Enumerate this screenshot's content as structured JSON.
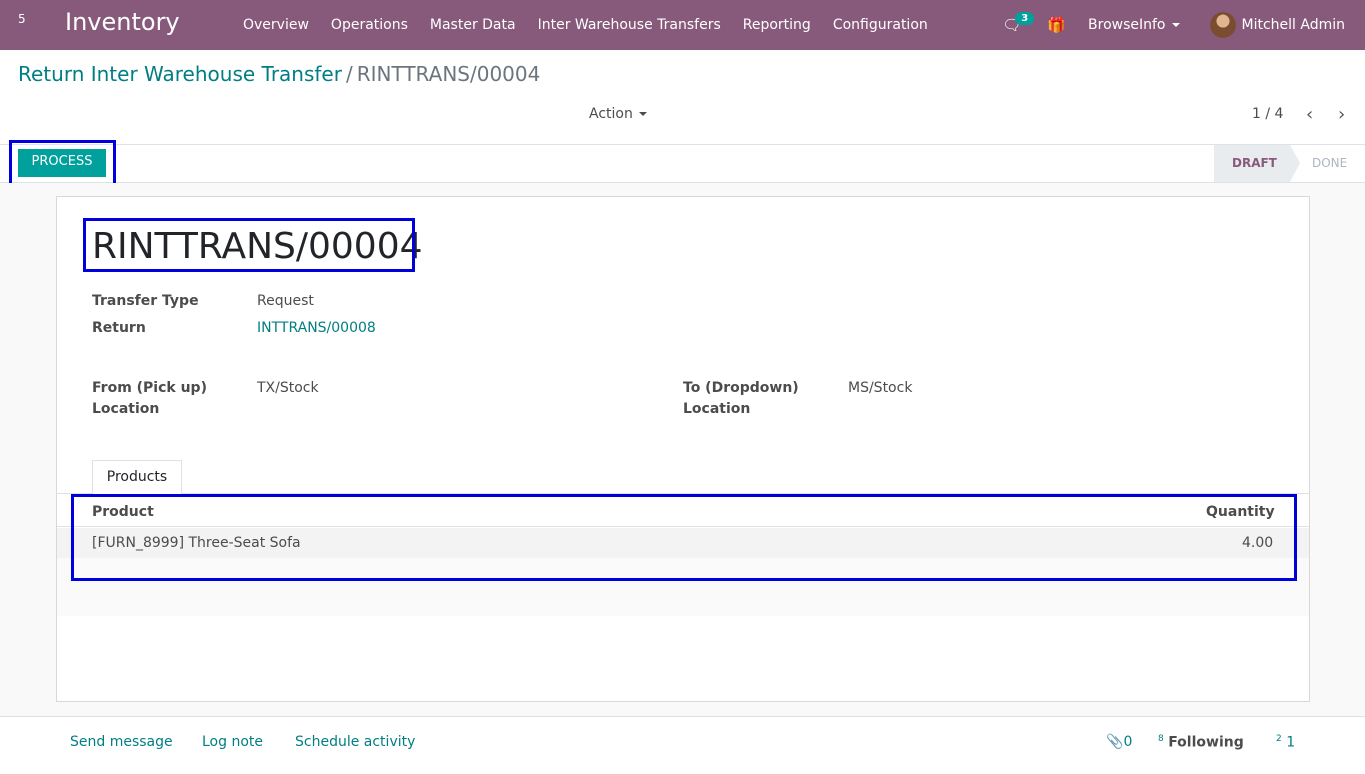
{
  "navbar": {
    "apps_label": "5",
    "brand": "Inventory",
    "menu": [
      "Overview",
      "Operations",
      "Master Data",
      "Inter Warehouse Transfers",
      "Reporting",
      "Configuration"
    ],
    "messages_count": "3",
    "company_menu": "BrowseInfo",
    "user_name": "Mitchell Admin"
  },
  "breadcrumb": {
    "parent": "Return Inter Warehouse Transfer",
    "separator": "/",
    "current": "RINTTRANS/00004"
  },
  "control": {
    "action_label": "Action",
    "pager": "1 / 4"
  },
  "statusbar": {
    "process_label": "PROCESS",
    "stages": [
      "DRAFT",
      "DONE"
    ],
    "active_stage": "DRAFT"
  },
  "form": {
    "record_name": "RINTTRANS/00004",
    "transfer_type_label": "Transfer Type",
    "transfer_type_value": "Request",
    "return_label": "Return",
    "return_value": "INTTRANS/00008",
    "from_label_1": "From (Pick up)",
    "from_label_2": "Location",
    "from_value": "TX/Stock",
    "to_label_1": "To (Dropdown)",
    "to_label_2": "Location",
    "to_value": "MS/Stock"
  },
  "tabs": {
    "products": "Products"
  },
  "table": {
    "headers": {
      "product": "Product",
      "quantity": "Quantity"
    },
    "rows": [
      {
        "product": "[FURN_8999] Three-Seat Sofa",
        "quantity": "4.00"
      }
    ]
  },
  "chatter": {
    "send_message": "Send message",
    "log_note": "Log note",
    "schedule_activity": "Schedule activity",
    "attachments_count": "0",
    "followers_prefix": "8",
    "following_label": "Following",
    "followers_suffix_prefix": "2",
    "followers_count": "1"
  },
  "colors": {
    "navbar": "#875a7b",
    "primary": "#00a09d",
    "link": "#017e84",
    "highlight": "#0000dd"
  }
}
